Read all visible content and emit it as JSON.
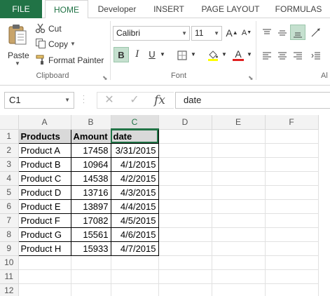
{
  "ribbon_tabs": [
    "FILE",
    "HOME",
    "Developer",
    "INSERT",
    "PAGE LAYOUT",
    "FORMULAS"
  ],
  "clipboard": {
    "paste_label": "Paste",
    "cut_label": "Cut",
    "copy_label": "Copy",
    "format_painter_label": "Format Painter",
    "group_label": "Clipboard"
  },
  "font": {
    "name": "Calibri",
    "size": "11",
    "group_label": "Font",
    "bold_label": "B",
    "italic_label": "I",
    "underline_label": "U",
    "grow_label": "A",
    "shrink_label": "A",
    "color_label": "A",
    "font_color": "#e02020"
  },
  "alignment": {
    "group_label": "Al"
  },
  "formula_bar": {
    "name_box": "C1",
    "fx_label": "fx",
    "value": "date"
  },
  "sheet": {
    "columns": [
      "A",
      "B",
      "C",
      "D",
      "E",
      "F"
    ],
    "row_numbers": [
      "1",
      "2",
      "3",
      "4",
      "5",
      "6",
      "7",
      "8",
      "9",
      "10",
      "11",
      "12"
    ],
    "header": [
      "Products",
      "Amount",
      "date"
    ],
    "rows": [
      [
        "Product A",
        "17458",
        "3/31/2015"
      ],
      [
        "Product B",
        "10964",
        "4/1/2015"
      ],
      [
        "Product C",
        "14538",
        "4/2/2015"
      ],
      [
        "Product D",
        "13716",
        "4/3/2015"
      ],
      [
        "Product E",
        "13897",
        "4/4/2015"
      ],
      [
        "Product F",
        "17082",
        "4/5/2015"
      ],
      [
        "Product G",
        "15561",
        "4/6/2015"
      ],
      [
        "Product H",
        "15933",
        "4/7/2015"
      ]
    ],
    "selected_cell": "C1"
  },
  "colors": {
    "accent": "#217346",
    "header_fill": "#d9d9d9"
  }
}
